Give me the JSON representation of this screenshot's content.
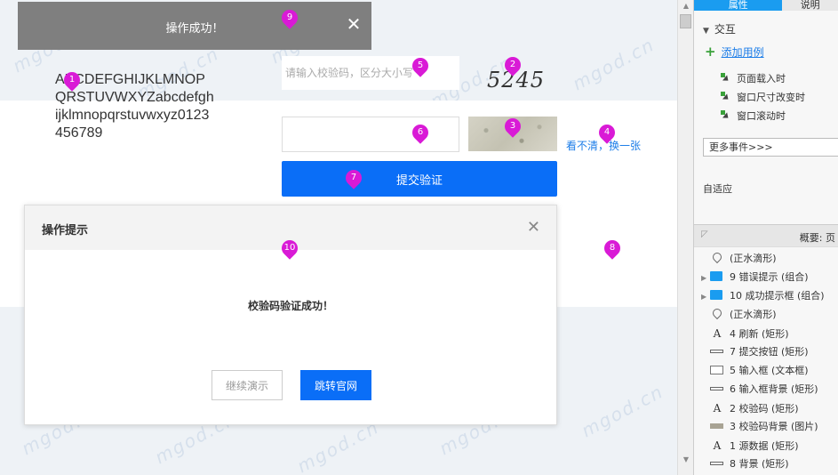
{
  "canvas": {
    "watermark": "mgod.cn",
    "source_text": "ABCDEFGHIJKLMNOPQRSTUVWXYZabcdefghijklmnopqrstuvwxyz0123456789",
    "code_input_placeholder": "请输入校验码，区分大小写",
    "code_text": "5245",
    "refresh_link": "看不清，换一张",
    "submit_label": "提交验证"
  },
  "markers": [
    "1",
    "2",
    "3",
    "4",
    "5",
    "6",
    "7",
    "8",
    "9",
    "10"
  ],
  "toast": {
    "text": "操作成功！",
    "close": "✕"
  },
  "dialog": {
    "title": "操作提示",
    "close": "✕",
    "message": "校验码验证成功！",
    "continue_label": "继续演示",
    "official_label": "跳转官网"
  },
  "panel": {
    "tab_properties": "属性",
    "tab_notes": "说明",
    "interaction_title": "交互",
    "add_case": "添加用例",
    "events": [
      "页面载入时",
      "窗口尺寸改变时",
      "窗口滚动时"
    ],
    "more_events": "更多事件>>>",
    "adaptive": "自适应",
    "outline_title": "概要: 页",
    "outline_items": [
      {
        "icon": "pin",
        "label": "(正水滴形)",
        "expandable": false
      },
      {
        "icon": "folder",
        "label": "9 错误提示 (组合)",
        "expandable": true
      },
      {
        "icon": "folder",
        "label": "10 成功提示框 (组合)",
        "expandable": true
      },
      {
        "icon": "pin",
        "label": "(正水滴形)",
        "expandable": false
      },
      {
        "icon": "text",
        "label": "4 刷新 (矩形)",
        "expandable": false
      },
      {
        "icon": "rect",
        "label": "7 提交按钮 (矩形)",
        "expandable": false
      },
      {
        "icon": "box",
        "label": "5 输入框 (文本框)",
        "expandable": false
      },
      {
        "icon": "rect",
        "label": "6 输入框背景 (矩形)",
        "expandable": false
      },
      {
        "icon": "text",
        "label": "2 校验码 (矩形)",
        "expandable": false
      },
      {
        "icon": "image",
        "label": "3 校验码背景 (图片)",
        "expandable": false
      },
      {
        "icon": "text",
        "label": "1 源数据 (矩形)",
        "expandable": false
      },
      {
        "icon": "rect",
        "label": "8 背景 (矩形)",
        "expandable": false
      }
    ]
  },
  "colors": {
    "accent_blue": "#0a6ef7",
    "tab_blue": "#1a9cf0",
    "marker_magenta": "#d91ad6",
    "toast_gray": "#7f7f7f"
  }
}
